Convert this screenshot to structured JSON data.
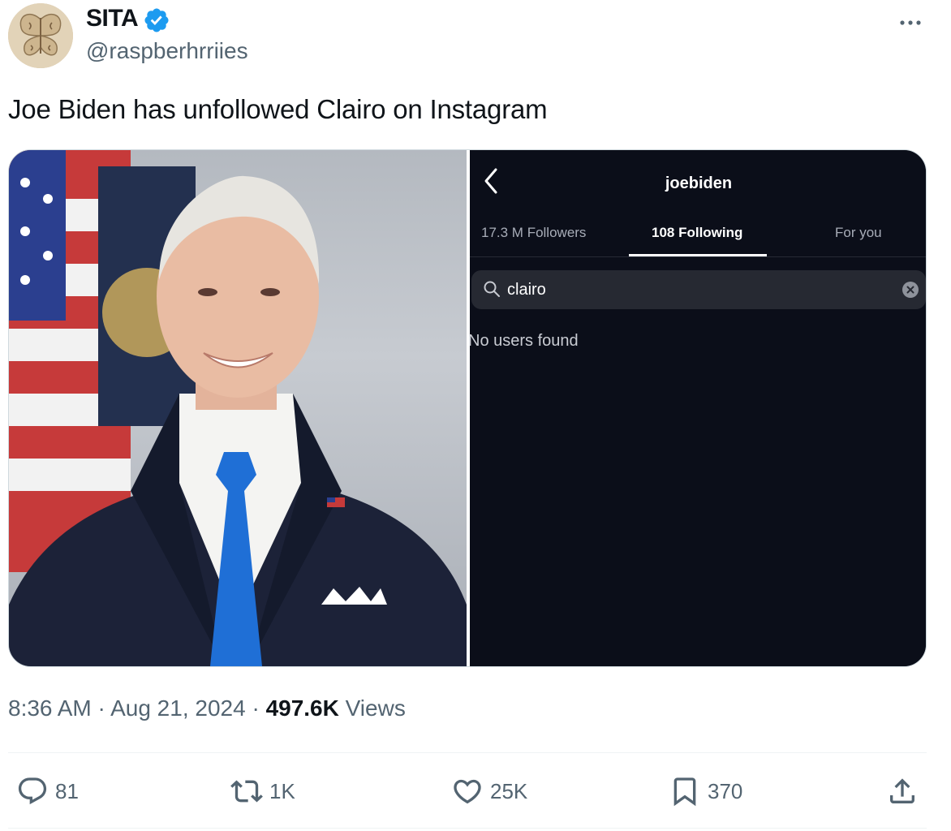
{
  "author": {
    "display_name": "SITA",
    "handle": "@raspberhrriies",
    "verified_icon": "verified-badge-icon",
    "colors": {
      "verified": "#1d9bf0"
    }
  },
  "tweet": {
    "text": "Joe Biden has unfollowed Clairo on Instagram"
  },
  "media": {
    "instagram_screenshot": {
      "title": "joebiden",
      "tabs": [
        {
          "label": "17.3 M Followers",
          "active": false
        },
        {
          "label": "108 Following",
          "active": true
        },
        {
          "label": "For you",
          "active": false
        }
      ],
      "search": {
        "value": "clairo"
      },
      "empty_message": "No users found"
    }
  },
  "meta": {
    "time": "8:36 AM",
    "separator": "·",
    "date": "Aug 21, 2024",
    "views_count": "497.6K",
    "views_label": "Views"
  },
  "actions": {
    "reply": {
      "icon": "reply-icon",
      "count": "81"
    },
    "retweet": {
      "icon": "retweet-icon",
      "count": "1K"
    },
    "like": {
      "icon": "heart-icon",
      "count": "25K"
    },
    "bookmark": {
      "icon": "bookmark-icon",
      "count": "370"
    },
    "share": {
      "icon": "share-icon"
    }
  }
}
